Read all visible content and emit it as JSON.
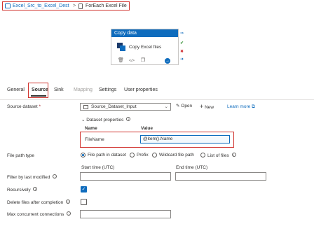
{
  "breadcrumb": {
    "pipeline": "Excel_Src_to_Excel_Dest",
    "separator": ">",
    "activity": "ForEach Excel File"
  },
  "canvas": {
    "activity_header": "Copy data",
    "activity_name": "Copy Excel files"
  },
  "tabs": [
    "General",
    "Source",
    "Sink",
    "Mapping",
    "Settings",
    "User properties"
  ],
  "source": {
    "dataset_label": "Source dataset",
    "required_mark": "*",
    "dataset_value": "Source_Dataset_Input",
    "open_label": "Open",
    "new_label": "New",
    "learn_more": "Learn more",
    "dataset_properties_label": "Dataset properties",
    "col_name": "Name",
    "col_value": "Value",
    "property_name": "FileName",
    "property_value": "@item().Name",
    "file_path_type_label": "File path type",
    "file_path_options": [
      "File path in dataset",
      "Prefix",
      "Wildcard file path",
      "List of files"
    ],
    "selected_file_path_option": "File path in dataset",
    "start_time_label": "Start time (UTC)",
    "end_time_label": "End time (UTC)",
    "filter_label": "Filter by last modified",
    "recursively_label": "Recursively",
    "recursively_checked": true,
    "delete_label": "Delete files after completion",
    "delete_checked": false,
    "max_conn_label": "Max concurrent connections"
  },
  "colors": {
    "accent": "#0f6cbd",
    "highlight_border": "#d1342f"
  }
}
